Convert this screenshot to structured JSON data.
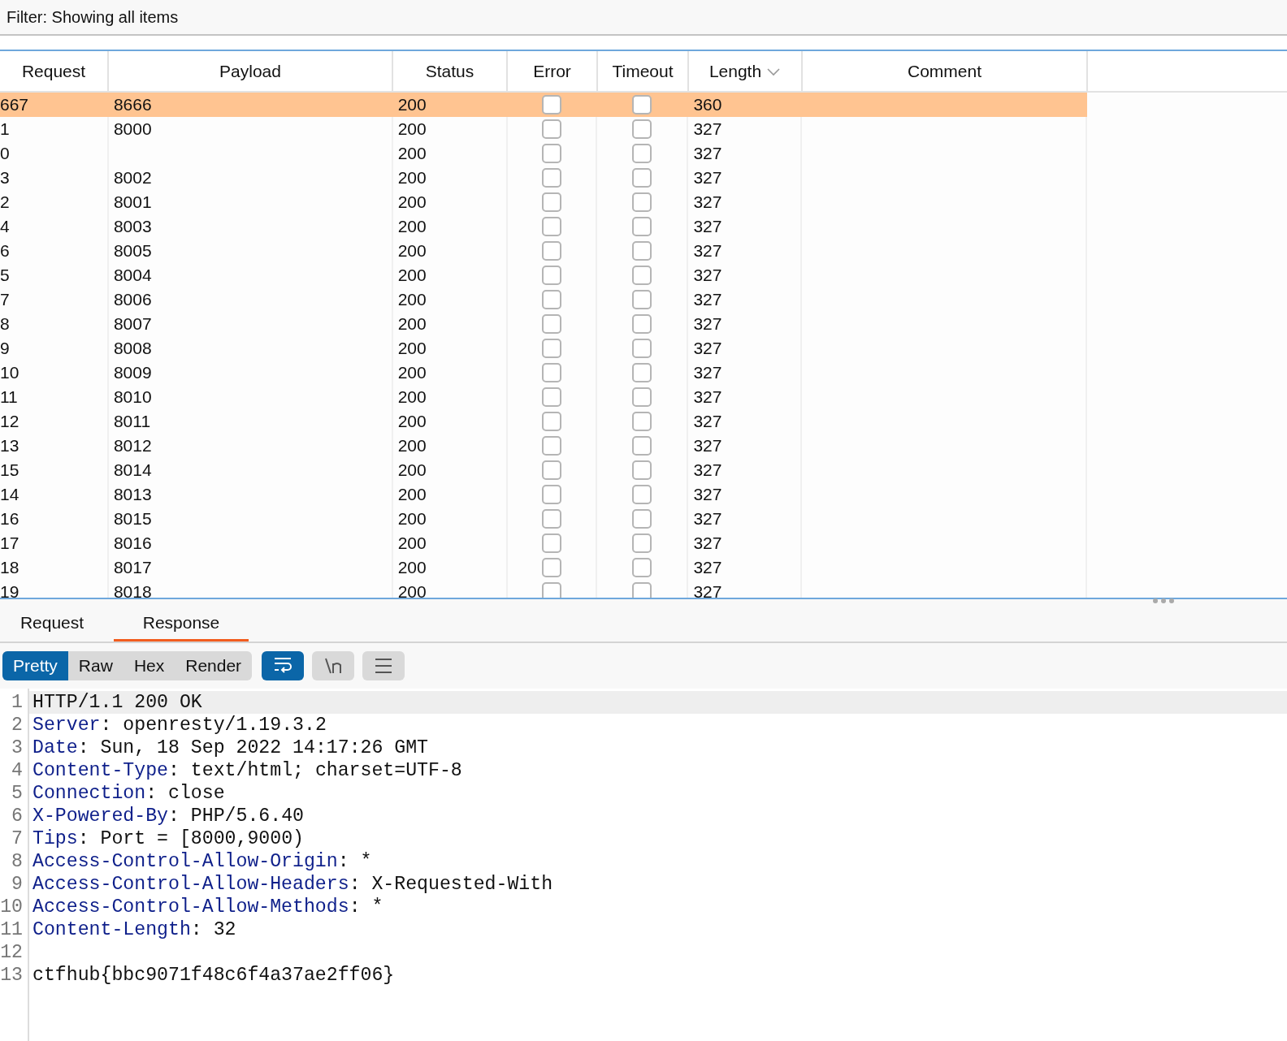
{
  "filter": {
    "text": "Filter: Showing all items"
  },
  "table": {
    "columns": [
      {
        "label": "Request",
        "sorted": false
      },
      {
        "label": "Payload",
        "sorted": false
      },
      {
        "label": "Status",
        "sorted": false
      },
      {
        "label": "Error",
        "sorted": false
      },
      {
        "label": "Timeout",
        "sorted": false
      },
      {
        "label": "Length",
        "sorted": true
      },
      {
        "label": "Comment",
        "sorted": false
      }
    ],
    "rows": [
      {
        "request": "667",
        "payload": "8666",
        "status": "200",
        "error": false,
        "timeout": false,
        "length": "360",
        "selected": true
      },
      {
        "request": "1",
        "payload": "8000",
        "status": "200",
        "error": false,
        "timeout": false,
        "length": "327",
        "selected": false
      },
      {
        "request": "0",
        "status": "200",
        "error": false,
        "timeout": false,
        "length": "327",
        "selected": false
      },
      {
        "request": "3",
        "payload": "8002",
        "status": "200",
        "error": false,
        "timeout": false,
        "length": "327",
        "selected": false
      },
      {
        "request": "2",
        "payload": "8001",
        "status": "200",
        "error": false,
        "timeout": false,
        "length": "327",
        "selected": false
      },
      {
        "request": "4",
        "payload": "8003",
        "status": "200",
        "error": false,
        "timeout": false,
        "length": "327",
        "selected": false
      },
      {
        "request": "6",
        "payload": "8005",
        "status": "200",
        "error": false,
        "timeout": false,
        "length": "327",
        "selected": false
      },
      {
        "request": "5",
        "payload": "8004",
        "status": "200",
        "error": false,
        "timeout": false,
        "length": "327",
        "selected": false
      },
      {
        "request": "7",
        "payload": "8006",
        "status": "200",
        "error": false,
        "timeout": false,
        "length": "327",
        "selected": false
      },
      {
        "request": "8",
        "payload": "8007",
        "status": "200",
        "error": false,
        "timeout": false,
        "length": "327",
        "selected": false
      },
      {
        "request": "9",
        "payload": "8008",
        "status": "200",
        "error": false,
        "timeout": false,
        "length": "327",
        "selected": false
      },
      {
        "request": "10",
        "payload": "8009",
        "status": "200",
        "error": false,
        "timeout": false,
        "length": "327",
        "selected": false
      },
      {
        "request": "11",
        "payload": "8010",
        "status": "200",
        "error": false,
        "timeout": false,
        "length": "327",
        "selected": false
      },
      {
        "request": "12",
        "payload": "8011",
        "status": "200",
        "error": false,
        "timeout": false,
        "length": "327",
        "selected": false
      },
      {
        "request": "13",
        "payload": "8012",
        "status": "200",
        "error": false,
        "timeout": false,
        "length": "327",
        "selected": false
      },
      {
        "request": "15",
        "payload": "8014",
        "status": "200",
        "error": false,
        "timeout": false,
        "length": "327",
        "selected": false
      },
      {
        "request": "14",
        "payload": "8013",
        "status": "200",
        "error": false,
        "timeout": false,
        "length": "327",
        "selected": false
      },
      {
        "request": "16",
        "payload": "8015",
        "status": "200",
        "error": false,
        "timeout": false,
        "length": "327",
        "selected": false
      },
      {
        "request": "17",
        "payload": "8016",
        "status": "200",
        "error": false,
        "timeout": false,
        "length": "327",
        "selected": false
      },
      {
        "request": "18",
        "payload": "8017",
        "status": "200",
        "error": false,
        "timeout": false,
        "length": "327",
        "selected": false
      },
      {
        "request": "19",
        "payload": "8018",
        "status": "200",
        "error": false,
        "timeout": false,
        "length": "327",
        "selected": false
      }
    ]
  },
  "tabs": [
    {
      "label": "Request",
      "selected": false
    },
    {
      "label": "Response",
      "selected": true
    }
  ],
  "view_modes": [
    {
      "label": "Pretty",
      "selected": true
    },
    {
      "label": "Raw",
      "selected": false
    },
    {
      "label": "Hex",
      "selected": false
    },
    {
      "label": "Render",
      "selected": false
    }
  ],
  "toolbar_buttons": [
    {
      "kind": "wrap",
      "on": true
    },
    {
      "kind": "newline",
      "on": false
    },
    {
      "kind": "menu",
      "on": false
    }
  ],
  "code_lines": [
    {
      "number": "1",
      "kind": "plain",
      "text": "HTTP/1.1 200 OK",
      "current": true
    },
    {
      "number": "2",
      "kind": "header",
      "key": "Server",
      "value": ": openresty/1.19.3.2",
      "current": false
    },
    {
      "number": "3",
      "kind": "header",
      "key": "Date",
      "value": ": Sun, 18 Sep 2022 14:17:26 GMT",
      "current": false
    },
    {
      "number": "4",
      "kind": "header",
      "key": "Content-Type",
      "value": ": text/html; charset=UTF-8",
      "current": false
    },
    {
      "number": "5",
      "kind": "header",
      "key": "Connection",
      "value": ": close",
      "current": false
    },
    {
      "number": "6",
      "kind": "header",
      "key": "X-Powered-By",
      "value": ": PHP/5.6.40",
      "current": false
    },
    {
      "number": "7",
      "kind": "header",
      "key": "Tips",
      "value": ": Port = [8000,9000)",
      "current": false
    },
    {
      "number": "8",
      "kind": "header",
      "key": "Access-Control-Allow-Origin",
      "value": ": *",
      "current": false
    },
    {
      "number": "9",
      "kind": "header",
      "key": "Access-Control-Allow-Headers",
      "value": ": X-Requested-With",
      "current": false
    },
    {
      "number": "10",
      "kind": "header",
      "key": "Access-Control-Allow-Methods",
      "value": ": *",
      "current": false
    },
    {
      "number": "11",
      "kind": "header",
      "key": "Content-Length",
      "value": ": 32",
      "current": false
    },
    {
      "number": "12",
      "kind": "empty",
      "current": false
    },
    {
      "number": "13",
      "kind": "plain",
      "text": "ctfhub{bbc9071f48c6f4a37ae2ff06}",
      "current": false
    }
  ]
}
